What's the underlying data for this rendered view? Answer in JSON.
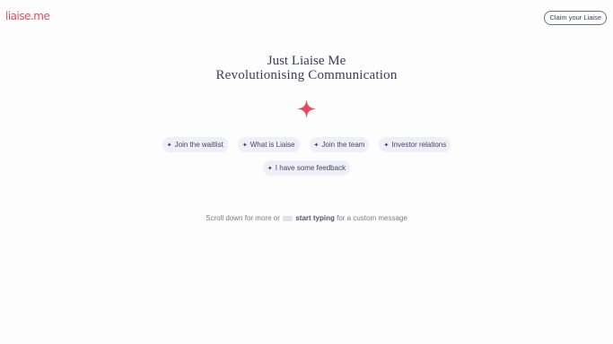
{
  "header": {
    "logo": "liaise.me",
    "claim_label": "Claim your Liaise"
  },
  "hero": {
    "line1": "Just Liaise Me",
    "line2": "Revolutionising Communication"
  },
  "colors": {
    "accent": "#e8495a",
    "ink": "#3a3d63",
    "chip_bg": "#eeeff8"
  },
  "icons": {
    "sparkle": "sparkle-icon",
    "chip": "star-icon",
    "keyboard": "keyboard-icon"
  },
  "chips": [
    {
      "label": "Join the waitlist"
    },
    {
      "label": "What is Liaise"
    },
    {
      "label": "Join the team"
    },
    {
      "label": "Investor relations"
    },
    {
      "label": "I have some feedback"
    }
  ],
  "chip_star": "✦",
  "hint": {
    "prefix": "Scroll down for more or",
    "action": "start typing",
    "suffix": "for a custom message"
  }
}
